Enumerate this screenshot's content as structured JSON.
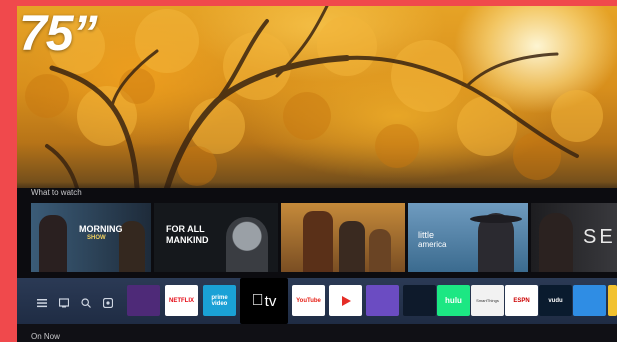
{
  "badge": {
    "size_text": "75”"
  },
  "sections": {
    "what_to_watch": "What to watch",
    "on_now": "On Now"
  },
  "tiles": [
    {
      "id": "morning-show",
      "title": "MORNING",
      "sub": "SHOW"
    },
    {
      "id": "for-all-mankind",
      "title_line1": "FOR ALL",
      "title_line2": "MANKIND"
    },
    {
      "id": "central-movie",
      "title": ""
    },
    {
      "id": "little-america",
      "title": "little",
      "sub": "america"
    },
    {
      "id": "see",
      "title": "SE"
    }
  ],
  "apps": [
    {
      "name": "Tubi",
      "label": "",
      "bg": "#4e2a78"
    },
    {
      "name": "Netflix",
      "label": "NETFLIX",
      "bg": "#ffffff",
      "fg": "#e50914"
    },
    {
      "name": "Prime Video",
      "label": "prime video",
      "bg": "#1aa1d6"
    },
    {
      "name": "Apple TV",
      "label": "tv",
      "bg": "#000000"
    },
    {
      "name": "YouTube",
      "label": "YouTube",
      "bg": "#ffffff",
      "fg": "#e62117"
    },
    {
      "name": "Google Play",
      "label": "",
      "bg": "#ffffff",
      "fg": "#e52d27"
    },
    {
      "name": "Sling",
      "label": "",
      "bg": "#6b4cc2"
    },
    {
      "name": "Prime",
      "label": "",
      "bg": "#0e1a2b"
    },
    {
      "name": "Hulu",
      "label": "hulu",
      "bg": "#1ce783"
    },
    {
      "name": "SmartThings",
      "label": "SmartThings",
      "bg": "#f2f2f2",
      "fg": "#333"
    },
    {
      "name": "ESPN",
      "label": "ESPN",
      "bg": "#ffffff",
      "fg": "#cc0000"
    },
    {
      "name": "Vudu",
      "label": "vudu",
      "bg": "#0a1b2e"
    },
    {
      "name": "Other",
      "label": "",
      "bg": "#2f8de4"
    },
    {
      "name": "Other2",
      "label": "",
      "bg": "#f2c230"
    }
  ],
  "colors": {
    "frame": "#f0494c",
    "app_bar": "#2b3a55",
    "screen_bg": "#0c0c10"
  }
}
